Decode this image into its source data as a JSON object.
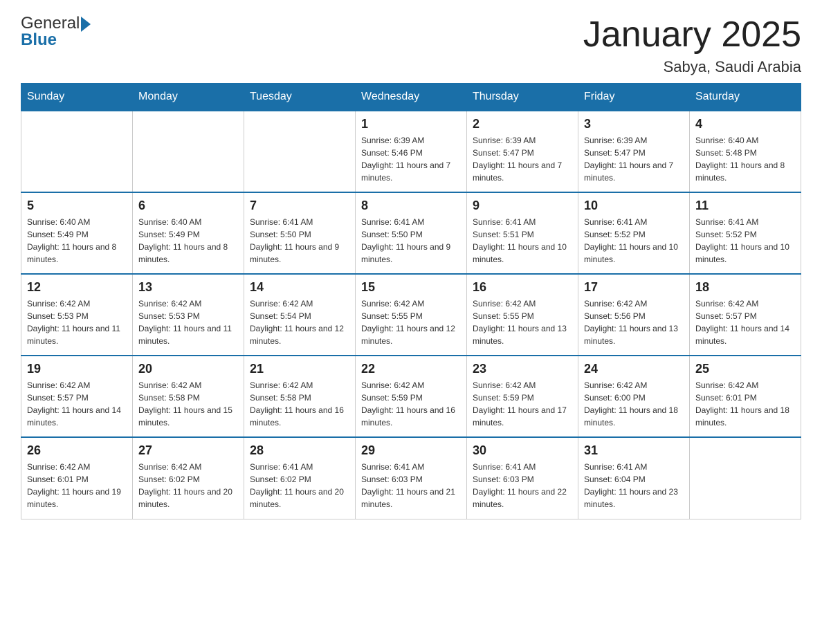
{
  "header": {
    "logo_general": "General",
    "logo_blue": "Blue",
    "month_title": "January 2025",
    "location": "Sabya, Saudi Arabia"
  },
  "days_of_week": [
    "Sunday",
    "Monday",
    "Tuesday",
    "Wednesday",
    "Thursday",
    "Friday",
    "Saturday"
  ],
  "weeks": [
    [
      {
        "day": "",
        "info": ""
      },
      {
        "day": "",
        "info": ""
      },
      {
        "day": "",
        "info": ""
      },
      {
        "day": "1",
        "info": "Sunrise: 6:39 AM\nSunset: 5:46 PM\nDaylight: 11 hours and 7 minutes."
      },
      {
        "day": "2",
        "info": "Sunrise: 6:39 AM\nSunset: 5:47 PM\nDaylight: 11 hours and 7 minutes."
      },
      {
        "day": "3",
        "info": "Sunrise: 6:39 AM\nSunset: 5:47 PM\nDaylight: 11 hours and 7 minutes."
      },
      {
        "day": "4",
        "info": "Sunrise: 6:40 AM\nSunset: 5:48 PM\nDaylight: 11 hours and 8 minutes."
      }
    ],
    [
      {
        "day": "5",
        "info": "Sunrise: 6:40 AM\nSunset: 5:49 PM\nDaylight: 11 hours and 8 minutes."
      },
      {
        "day": "6",
        "info": "Sunrise: 6:40 AM\nSunset: 5:49 PM\nDaylight: 11 hours and 8 minutes."
      },
      {
        "day": "7",
        "info": "Sunrise: 6:41 AM\nSunset: 5:50 PM\nDaylight: 11 hours and 9 minutes."
      },
      {
        "day": "8",
        "info": "Sunrise: 6:41 AM\nSunset: 5:50 PM\nDaylight: 11 hours and 9 minutes."
      },
      {
        "day": "9",
        "info": "Sunrise: 6:41 AM\nSunset: 5:51 PM\nDaylight: 11 hours and 10 minutes."
      },
      {
        "day": "10",
        "info": "Sunrise: 6:41 AM\nSunset: 5:52 PM\nDaylight: 11 hours and 10 minutes."
      },
      {
        "day": "11",
        "info": "Sunrise: 6:41 AM\nSunset: 5:52 PM\nDaylight: 11 hours and 10 minutes."
      }
    ],
    [
      {
        "day": "12",
        "info": "Sunrise: 6:42 AM\nSunset: 5:53 PM\nDaylight: 11 hours and 11 minutes."
      },
      {
        "day": "13",
        "info": "Sunrise: 6:42 AM\nSunset: 5:53 PM\nDaylight: 11 hours and 11 minutes."
      },
      {
        "day": "14",
        "info": "Sunrise: 6:42 AM\nSunset: 5:54 PM\nDaylight: 11 hours and 12 minutes."
      },
      {
        "day": "15",
        "info": "Sunrise: 6:42 AM\nSunset: 5:55 PM\nDaylight: 11 hours and 12 minutes."
      },
      {
        "day": "16",
        "info": "Sunrise: 6:42 AM\nSunset: 5:55 PM\nDaylight: 11 hours and 13 minutes."
      },
      {
        "day": "17",
        "info": "Sunrise: 6:42 AM\nSunset: 5:56 PM\nDaylight: 11 hours and 13 minutes."
      },
      {
        "day": "18",
        "info": "Sunrise: 6:42 AM\nSunset: 5:57 PM\nDaylight: 11 hours and 14 minutes."
      }
    ],
    [
      {
        "day": "19",
        "info": "Sunrise: 6:42 AM\nSunset: 5:57 PM\nDaylight: 11 hours and 14 minutes."
      },
      {
        "day": "20",
        "info": "Sunrise: 6:42 AM\nSunset: 5:58 PM\nDaylight: 11 hours and 15 minutes."
      },
      {
        "day": "21",
        "info": "Sunrise: 6:42 AM\nSunset: 5:58 PM\nDaylight: 11 hours and 16 minutes."
      },
      {
        "day": "22",
        "info": "Sunrise: 6:42 AM\nSunset: 5:59 PM\nDaylight: 11 hours and 16 minutes."
      },
      {
        "day": "23",
        "info": "Sunrise: 6:42 AM\nSunset: 5:59 PM\nDaylight: 11 hours and 17 minutes."
      },
      {
        "day": "24",
        "info": "Sunrise: 6:42 AM\nSunset: 6:00 PM\nDaylight: 11 hours and 18 minutes."
      },
      {
        "day": "25",
        "info": "Sunrise: 6:42 AM\nSunset: 6:01 PM\nDaylight: 11 hours and 18 minutes."
      }
    ],
    [
      {
        "day": "26",
        "info": "Sunrise: 6:42 AM\nSunset: 6:01 PM\nDaylight: 11 hours and 19 minutes."
      },
      {
        "day": "27",
        "info": "Sunrise: 6:42 AM\nSunset: 6:02 PM\nDaylight: 11 hours and 20 minutes."
      },
      {
        "day": "28",
        "info": "Sunrise: 6:41 AM\nSunset: 6:02 PM\nDaylight: 11 hours and 20 minutes."
      },
      {
        "day": "29",
        "info": "Sunrise: 6:41 AM\nSunset: 6:03 PM\nDaylight: 11 hours and 21 minutes."
      },
      {
        "day": "30",
        "info": "Sunrise: 6:41 AM\nSunset: 6:03 PM\nDaylight: 11 hours and 22 minutes."
      },
      {
        "day": "31",
        "info": "Sunrise: 6:41 AM\nSunset: 6:04 PM\nDaylight: 11 hours and 23 minutes."
      },
      {
        "day": "",
        "info": ""
      }
    ]
  ]
}
